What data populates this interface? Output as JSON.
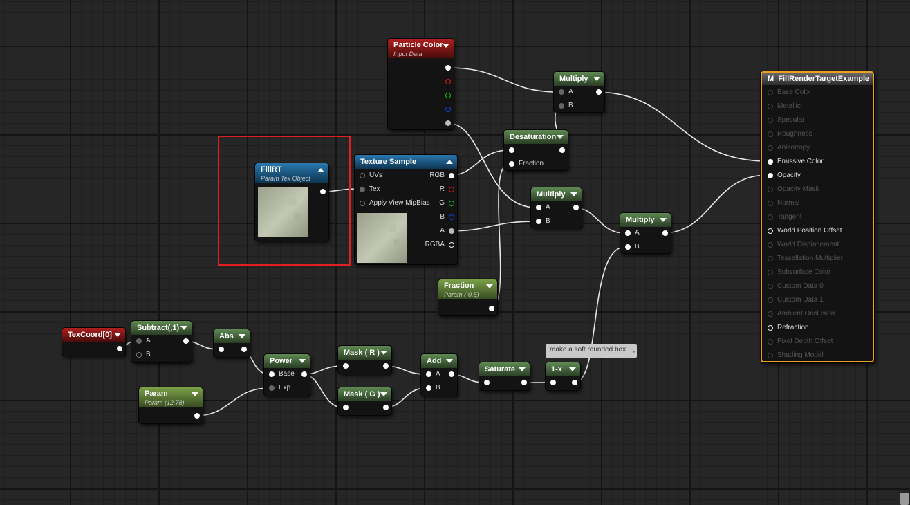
{
  "colors": {
    "accent_selection": "#e02020",
    "result_border": "#e8a020",
    "pin_red": "#e01818",
    "pin_green": "#18c018",
    "pin_blue": "#1840e0"
  },
  "nodes": {
    "particle_color": {
      "title": "Particle Color",
      "subtitle": "Input Data"
    },
    "multiply_top": {
      "title": "Multiply",
      "pin_a": "A",
      "pin_b": "B"
    },
    "desaturation": {
      "title": "Desaturation",
      "pin_fraction": "Fraction"
    },
    "fillrt": {
      "title": "FillRT",
      "subtitle": "Param Tex Object"
    },
    "texture_sample": {
      "title": "Texture Sample",
      "pin_uvs": "UVs",
      "pin_tex": "Tex",
      "pin_mipbias": "Apply View MipBias",
      "out_rgb": "RGB",
      "out_r": "R",
      "out_g": "G",
      "out_b": "B",
      "out_a": "A",
      "out_rgba": "RGBA"
    },
    "multiply_mid": {
      "title": "Multiply",
      "pin_a": "A",
      "pin_b": "B"
    },
    "multiply_right": {
      "title": "Multiply",
      "pin_a": "A",
      "pin_b": "B"
    },
    "fraction_param": {
      "title": "Fraction",
      "subtitle": "Param (-0.5)"
    },
    "texcoord": {
      "title": "TexCoord[0]"
    },
    "subtract": {
      "title": "Subtract(,1)",
      "pin_a": "A",
      "pin_b": "B"
    },
    "abs": {
      "title": "Abs"
    },
    "power": {
      "title": "Power",
      "pin_base": "Base",
      "pin_exp": "Exp"
    },
    "param": {
      "title": "Param",
      "subtitle": "Param (12.78)"
    },
    "mask_r": {
      "title": "Mask ( R )"
    },
    "mask_g": {
      "title": "Mask ( G )"
    },
    "add": {
      "title": "Add",
      "pin_a": "A",
      "pin_b": "B"
    },
    "saturate": {
      "title": "Saturate"
    },
    "one_minus_x": {
      "title": "1-x"
    }
  },
  "comment": {
    "text": "make a soft rounded box"
  },
  "result_node": {
    "title": "M_FillRenderTargetExample",
    "inputs": [
      {
        "label": "Base Color",
        "enabled": false
      },
      {
        "label": "Metallic",
        "enabled": false
      },
      {
        "label": "Specular",
        "enabled": false
      },
      {
        "label": "Roughness",
        "enabled": false
      },
      {
        "label": "Anisotropy",
        "enabled": false
      },
      {
        "label": "Emissive Color",
        "enabled": true
      },
      {
        "label": "Opacity",
        "enabled": true
      },
      {
        "label": "Opacity Mask",
        "enabled": false
      },
      {
        "label": "Normal",
        "enabled": false
      },
      {
        "label": "Tangent",
        "enabled": false
      },
      {
        "label": "World Position Offset",
        "enabled": true
      },
      {
        "label": "World Displacement",
        "enabled": false
      },
      {
        "label": "Tessellation Multiplier",
        "enabled": false
      },
      {
        "label": "Subsurface Color",
        "enabled": false
      },
      {
        "label": "Custom Data 0",
        "enabled": false
      },
      {
        "label": "Custom Data 1",
        "enabled": false
      },
      {
        "label": "Ambient Occlusion",
        "enabled": false
      },
      {
        "label": "Refraction",
        "enabled": true
      },
      {
        "label": "Pixel Depth Offset",
        "enabled": false
      },
      {
        "label": "Shading Model",
        "enabled": false
      }
    ]
  }
}
